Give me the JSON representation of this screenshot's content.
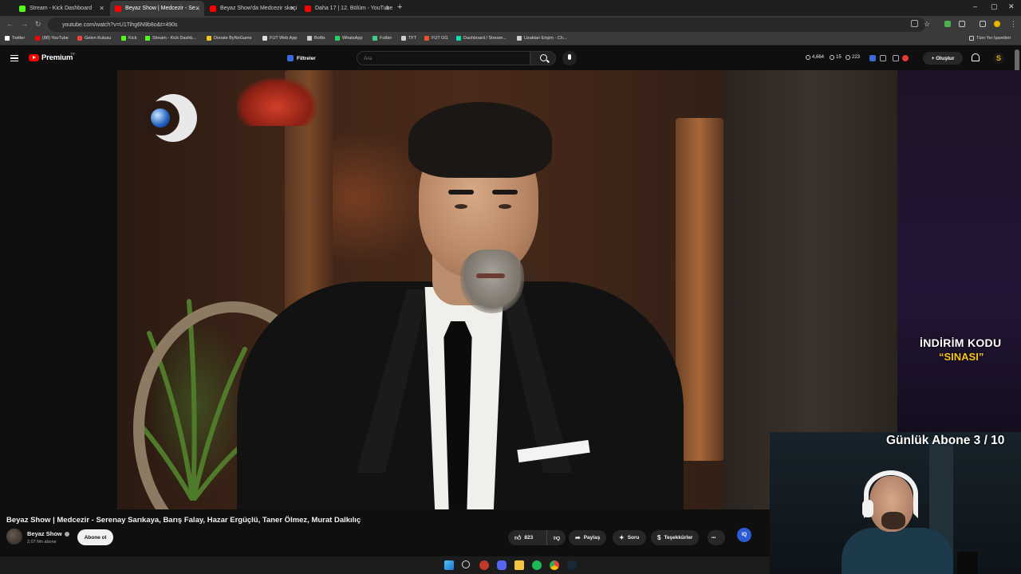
{
  "browser": {
    "tabs": [
      {
        "title": "Stream - Kick Dashboard",
        "favicon_color": "#53fc18",
        "active": false
      },
      {
        "title": "Beyaz Show | Medcezir - Se...",
        "favicon_color": "#ff0000",
        "active": true
      },
      {
        "title": "Beyaz Show'da Medcezir skeçi",
        "favicon_color": "#ff0000",
        "active": false
      },
      {
        "title": "Daha 17 | 12. Bölüm - YouTube",
        "favicon_color": "#ff0000",
        "active": false
      }
    ],
    "new_tab": "+",
    "url": "youtube.com/watch?v=U1Tihg6N9b8o&t=490s",
    "window_controls": {
      "minimize": "–",
      "maximize": "▢",
      "close": "✕"
    },
    "bookmarks": [
      {
        "label": "Twitter",
        "color": "#ffffff"
      },
      {
        "label": "(88) YouTube",
        "color": "#ff0000"
      },
      {
        "label": "Gelen Kutusu",
        "color": "#ea4335"
      },
      {
        "label": "Kick",
        "color": "#53fc18"
      },
      {
        "label": "Stream - Kick Dashb...",
        "color": "#53fc18"
      },
      {
        "label": "Donate ByNoGame",
        "color": "#f5c518"
      },
      {
        "label": "FUT Web App",
        "color": "#dddddd"
      },
      {
        "label": "Botfix",
        "color": "#cccccc"
      },
      {
        "label": "WhatsApp",
        "color": "#25d366"
      },
      {
        "label": "Futbin",
        "color": "#3ecf8e"
      },
      {
        "label": "TFT",
        "color": "#cccccc"
      },
      {
        "label": "FUT GG",
        "color": "#e5512c"
      },
      {
        "label": "Dashboard / Stream...",
        "color": "#00e0b0"
      },
      {
        "label": "Uzaktan Erişim - Ch...",
        "color": "#cccccc"
      }
    ],
    "all_bookmarks": "Tüm Yer İşaretleri"
  },
  "youtube": {
    "brand": "Premium",
    "country": "TR",
    "filter_label": "Filtreler",
    "search_placeholder": "Ara",
    "stats": [
      {
        "value": "4,664"
      },
      {
        "value": "15"
      },
      {
        "value": "223"
      }
    ],
    "create_label": "+ Oluştur",
    "avatar_letter": "S"
  },
  "overlay": {
    "promo_line1": "İNDİRİM KODU",
    "promo_line2": "“SINASI”",
    "sub_goal": "Günlük Abone 3 / 10"
  },
  "video": {
    "title": "Beyaz Show | Medcezir - Serenay Sarıkaya, Barış Falay, Hazar Ergüçlü, Taner Ölmez, Murat Dalkılıç",
    "channel": "Beyaz Show",
    "subscribers": "2,07 Mn abone",
    "subscribe_label": "Abone ol",
    "likes": "823",
    "share_label": "Paylaş",
    "ask_label": "Soru",
    "thanks_label": "Teşekkürler",
    "more_label": "•••",
    "ext_label": "IQ"
  },
  "colors": {
    "accent_red": "#ff0000",
    "promo_yellow": "#f5c518",
    "background": "#0f0f0f"
  }
}
